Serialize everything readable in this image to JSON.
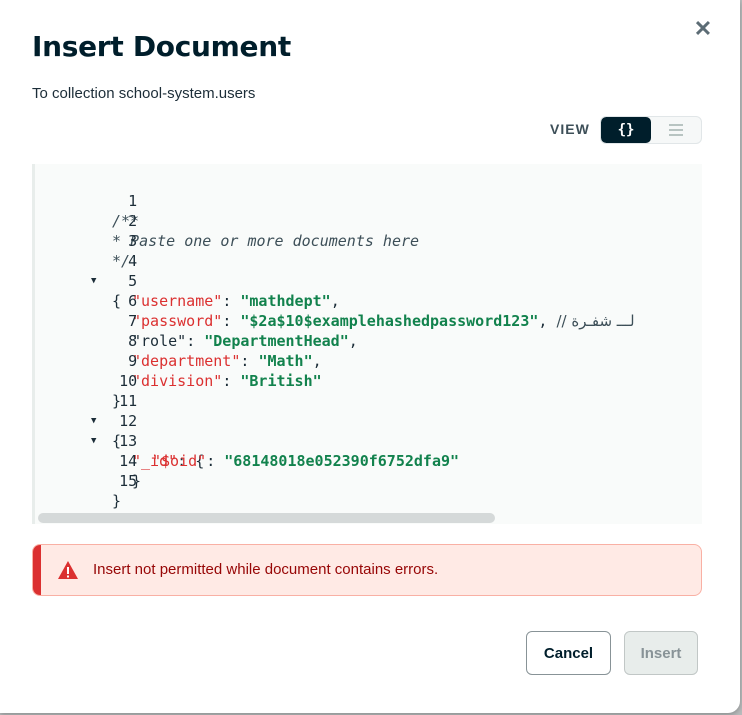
{
  "dialog": {
    "title": "Insert Document",
    "subtitle": "To collection school-system.users",
    "close_icon": "close-icon"
  },
  "view": {
    "label": "VIEW",
    "json_label": "{}",
    "list_icon": "list-icon",
    "selected": "json"
  },
  "editor": {
    "lines": [
      {
        "n": "1",
        "fold": false
      },
      {
        "n": "2",
        "fold": false
      },
      {
        "n": "3",
        "fold": false
      },
      {
        "n": "4",
        "fold": true
      },
      {
        "n": "5",
        "fold": false
      },
      {
        "n": "6",
        "fold": false
      },
      {
        "n": "7",
        "fold": false
      },
      {
        "n": "8",
        "fold": false
      },
      {
        "n": "9",
        "fold": false
      },
      {
        "n": "10",
        "fold": false
      },
      {
        "n": "11",
        "fold": true
      },
      {
        "n": "12",
        "fold": true
      },
      {
        "n": "13",
        "fold": false
      },
      {
        "n": "14",
        "fold": false
      },
      {
        "n": "15",
        "fold": false
      }
    ],
    "comment_1": "/**",
    "comment_2": "* Paste one or more documents here",
    "comment_3": "*/",
    "brace_open": "{",
    "brace_close": "}",
    "username_key": "\"username\"",
    "username_val": "\"mathdept\"",
    "password_key": "\"password\"",
    "password_val": "\"$2a$10$examplehashedpassword123\"",
    "password_comment": "// لـــ شفـرة",
    "role_key": "\"role\"",
    "role_val": "\"DepartmentHead\"",
    "department_key": "\"department\"",
    "department_val": "\"Math\"",
    "division_key": "\"division\"",
    "division_val": "\"British\"",
    "id_key": "\"_id\"",
    "oid_key": "\"$oid\"",
    "oid_val": "\"68148018e052390f6752dfa9\"",
    "colon": ": ",
    "comma": ","
  },
  "error": {
    "icon": "warning-icon",
    "message": "Insert not permitted while document contains errors.",
    "color": "#db3030"
  },
  "footer": {
    "cancel_label": "Cancel",
    "insert_label": "Insert"
  }
}
